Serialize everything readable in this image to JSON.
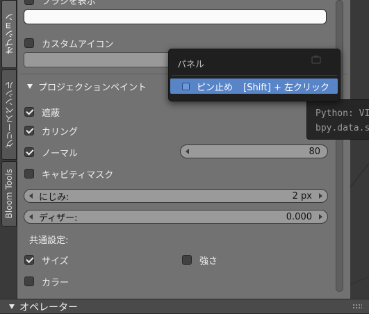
{
  "tabs": [
    {
      "label": "オプション",
      "active": true
    },
    {
      "label": "グリースペンシル",
      "active": false
    },
    {
      "label": "Bloom Tools",
      "active": false
    }
  ],
  "options": {
    "top_item_label": "ブラシを表示",
    "custom_icon_label": "カスタムアイコン",
    "projection_paint_header": "プロジェクションペイント",
    "occlude_label": "遮蔽",
    "culling_label": "カリング",
    "normal_label": "ノーマル",
    "normal_value": "80",
    "cavity_mask_label": "キャビティマスク",
    "bleed_label": "にじみ:",
    "bleed_value": "2 px",
    "dither_label": "ディザー:",
    "dither_value": "0.000",
    "common_settings_label": "共通設定:",
    "size_label": "サイズ",
    "strength_label": "強さ",
    "color_label": "カラー"
  },
  "checkbox_states": {
    "occlude": true,
    "culling": true,
    "normal": true,
    "cavity_mask": false,
    "size": true,
    "strength": false,
    "color": false,
    "custom_icon": false
  },
  "popup": {
    "title": "パネル",
    "item_label": "ピン止め",
    "item_shortcut": "[Shift] + 左クリック"
  },
  "tooltip": {
    "line1": "Python: VI",
    "line2": "bpy.data.s"
  },
  "bottom_panel": {
    "label": "オペレーター"
  },
  "colors": {
    "panel_bg": "#727272",
    "menu_bg": "#1f1f1f",
    "menu_highlight": "#5884c8",
    "tooltip_bg": "#262626"
  }
}
